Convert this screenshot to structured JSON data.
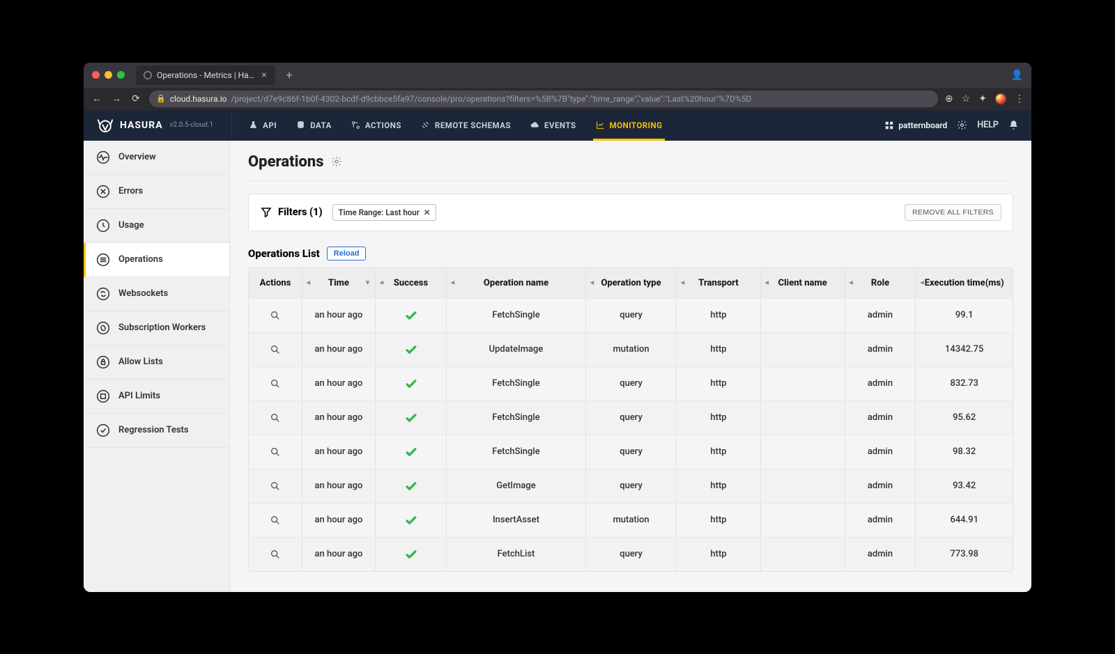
{
  "browser": {
    "tab_title": "Operations - Metrics | Hasura",
    "addr_host": "cloud.hasura.io",
    "addr_path": "/project/d7e9c86f-1b0f-4302-bcdf-d9cbbce5fa97/console/pro/operations?filters=%5B%7B\"type\":\"time_range\",\"value\":\"Last%20hour\"%7D%5D"
  },
  "topnav": {
    "brand": "HASURA",
    "version": "v2.0.5-cloud.1",
    "items": [
      {
        "label": "API"
      },
      {
        "label": "DATA"
      },
      {
        "label": "ACTIONS"
      },
      {
        "label": "REMOTE SCHEMAS"
      },
      {
        "label": "EVENTS"
      },
      {
        "label": "MONITORING"
      }
    ],
    "username": "patternboard",
    "help": "HELP"
  },
  "sidebar": {
    "items": [
      {
        "label": "Overview"
      },
      {
        "label": "Errors"
      },
      {
        "label": "Usage"
      },
      {
        "label": "Operations"
      },
      {
        "label": "Websockets"
      },
      {
        "label": "Subscription Workers"
      },
      {
        "label": "Allow Lists"
      },
      {
        "label": "API Limits"
      },
      {
        "label": "Regression Tests"
      }
    ],
    "active_index": 3
  },
  "page": {
    "title": "Operations",
    "filters_label": "Filters (1)",
    "filter_chip": "Time Range: Last hour",
    "remove_all": "REMOVE ALL FILTERS",
    "list_title": "Operations List",
    "reload_label": "Reload"
  },
  "table": {
    "columns": {
      "action": "Actions",
      "time": "Time",
      "success": "Success",
      "op_name": "Operation name",
      "op_type": "Operation type",
      "transport": "Transport",
      "client": "Client name",
      "role": "Role",
      "exec": "Execution time(ms)"
    },
    "rows": [
      {
        "time": "an hour ago",
        "success": true,
        "op_name": "FetchSingle",
        "op_type": "query",
        "transport": "http",
        "client": "",
        "role": "admin",
        "exec": "99.1"
      },
      {
        "time": "an hour ago",
        "success": true,
        "op_name": "UpdateImage",
        "op_type": "mutation",
        "transport": "http",
        "client": "",
        "role": "admin",
        "exec": "14342.75"
      },
      {
        "time": "an hour ago",
        "success": true,
        "op_name": "FetchSingle",
        "op_type": "query",
        "transport": "http",
        "client": "",
        "role": "admin",
        "exec": "832.73"
      },
      {
        "time": "an hour ago",
        "success": true,
        "op_name": "FetchSingle",
        "op_type": "query",
        "transport": "http",
        "client": "",
        "role": "admin",
        "exec": "95.62"
      },
      {
        "time": "an hour ago",
        "success": true,
        "op_name": "FetchSingle",
        "op_type": "query",
        "transport": "http",
        "client": "",
        "role": "admin",
        "exec": "98.32"
      },
      {
        "time": "an hour ago",
        "success": true,
        "op_name": "GetImage",
        "op_type": "query",
        "transport": "http",
        "client": "",
        "role": "admin",
        "exec": "93.42"
      },
      {
        "time": "an hour ago",
        "success": true,
        "op_name": "InsertAsset",
        "op_type": "mutation",
        "transport": "http",
        "client": "",
        "role": "admin",
        "exec": "644.91"
      },
      {
        "time": "an hour ago",
        "success": true,
        "op_name": "FetchList",
        "op_type": "query",
        "transport": "http",
        "client": "",
        "role": "admin",
        "exec": "773.98"
      }
    ]
  }
}
